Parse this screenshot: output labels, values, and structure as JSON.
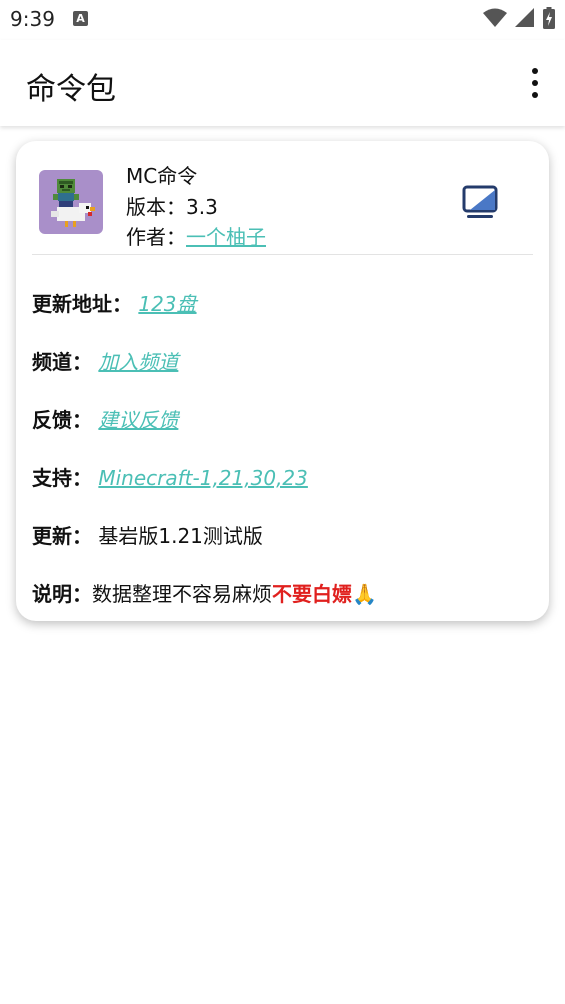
{
  "status_bar": {
    "time": "9:39",
    "notif_letter": "A"
  },
  "app_bar": {
    "title": "命令包",
    "menu_icon": "more-vert-icon"
  },
  "card": {
    "name": "MC命令",
    "version_label": "版本：",
    "version": "3.3",
    "author_label": "作者：",
    "author": "一个柚子",
    "rows": {
      "update_addr": {
        "label": "更新地址：",
        "value": "123盘"
      },
      "channel": {
        "label": "频道：",
        "value": "加入频道"
      },
      "feedback": {
        "label": "反馈：",
        "value": "建议反馈"
      },
      "support": {
        "label": "支持：",
        "value": "Minecraft-1,21,30,23"
      },
      "update": {
        "label": "更新：",
        "value": "基岩版1.21测试版"
      },
      "note": {
        "label": "说明：",
        "value": "数据整理不容易麻烦",
        "warning": "不要白嫖",
        "emoji": "🙏"
      }
    }
  },
  "colors": {
    "link": "#4bbfb5",
    "warning": "#e0201e",
    "avatar_bg": "#a98fc9"
  }
}
